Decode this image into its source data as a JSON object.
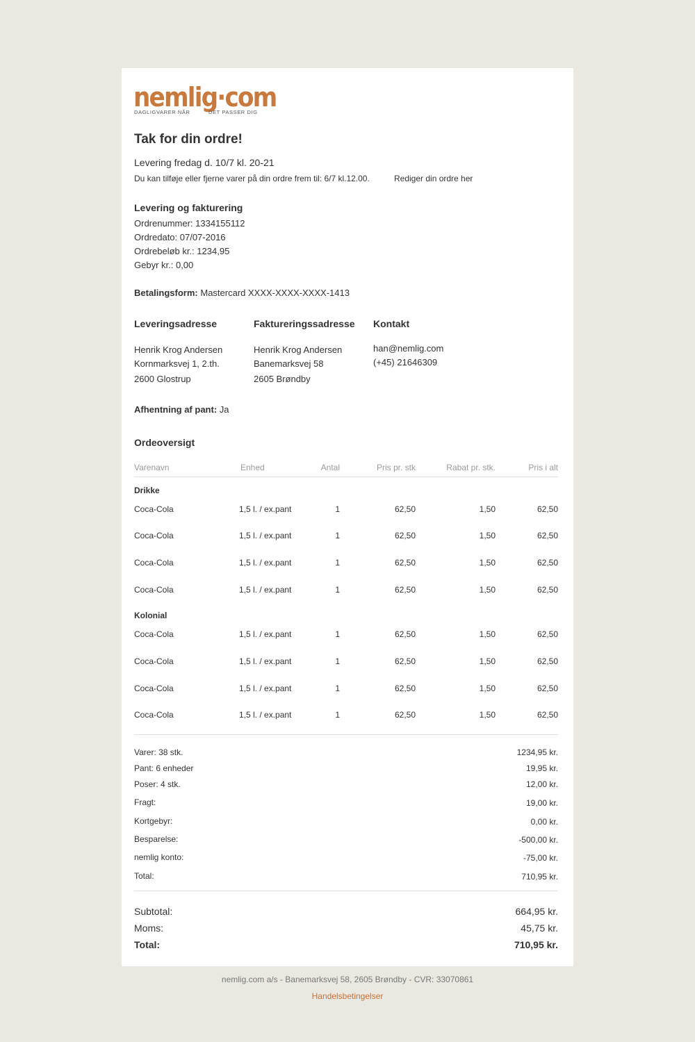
{
  "brand": {
    "logo_text": "nemlig·com",
    "tagline_left": "DAGLIGVARER NÅR",
    "tagline_right": "DET PASSER DIG"
  },
  "heading": "Tak for din ordre!",
  "delivery_line": "Levering fredag d. 10/7 kl. 20-21",
  "edit_note": "Du kan tilføje eller fjerne varer på din ordre frem til: 6/7 kl.12.00.",
  "edit_link": "Rediger din ordre her",
  "billing": {
    "heading": "Levering og fakturering",
    "order_number": "Ordrenummer: 1334155112",
    "order_date": "Ordredato: 07/07-2016",
    "order_amount": "Ordrebeløb kr.: 1234,95",
    "fee": "Gebyr kr.: 0,00"
  },
  "payment": {
    "label": "Betalingsform:",
    "value": "Mastercard XXXX-XXXX-XXXX-1413"
  },
  "addresses": {
    "delivery": {
      "heading": "Leveringsadresse",
      "name": "Henrik Krog Andersen",
      "street": "Kornmarksvej 1, 2.th.",
      "city": "2600 Glostrup"
    },
    "invoice": {
      "heading": "Faktureringssadresse",
      "name": "Henrik Krog Andersen",
      "street": "Banemarksvej 58",
      "city": "2605 Brøndby"
    },
    "contact": {
      "heading": "Kontakt",
      "email": "han@nemlig.com",
      "phone": "(+45) 21646309"
    }
  },
  "deposit_pickup": {
    "label": "Afhentning af pant:",
    "value": "Ja"
  },
  "overview": {
    "heading": "Ordeoversigt",
    "columns": [
      "Varenavn",
      "Enhed",
      "Antal",
      "Pris pr. stk",
      "Rabat pr. stk.",
      "Pris i alt"
    ],
    "groups": [
      {
        "name": "Drikke",
        "rows": [
          [
            "Coca-Cola",
            "1,5 l. / ex.pant",
            "1",
            "62,50",
            "1,50",
            "62,50"
          ],
          [
            "Coca-Cola",
            "1,5 l. / ex.pant",
            "1",
            "62,50",
            "1,50",
            "62,50"
          ],
          [
            "Coca-Cola",
            "1,5 l. / ex.pant",
            "1",
            "62,50",
            "1,50",
            "62,50"
          ],
          [
            "Coca-Cola",
            "1,5 l. / ex.pant",
            "1",
            "62,50",
            "1,50",
            "62,50"
          ]
        ]
      },
      {
        "name": "Kolonial",
        "rows": [
          [
            "Coca-Cola",
            "1,5 l. / ex.pant",
            "1",
            "62,50",
            "1,50",
            "62,50"
          ],
          [
            "Coca-Cola",
            "1,5 l. / ex.pant",
            "1",
            "62,50",
            "1,50",
            "62,50"
          ],
          [
            "Coca-Cola",
            "1,5 l. / ex.pant",
            "1",
            "62,50",
            "1,50",
            "62,50"
          ],
          [
            "Coca-Cola",
            "1,5 l. / ex.pant",
            "1",
            "62,50",
            "1,50",
            "62,50"
          ]
        ]
      }
    ]
  },
  "summary": [
    {
      "label": "Varer:  38 stk.",
      "value": "1234,95 kr.",
      "highlight": false
    },
    {
      "label": "Pant:  6 enheder",
      "value": "19,95 kr.",
      "highlight": false
    },
    {
      "label": "Poser:  4 stk.",
      "value": "12,00 kr.",
      "highlight": false
    },
    {
      "label": "Fragt:",
      "value": "19,00 kr.",
      "highlight": false
    },
    {
      "label": "Kortgebyr:",
      "value": "0,00 kr.",
      "highlight": false
    },
    {
      "label": "Besparelse:",
      "value": "-500,00 kr.",
      "highlight": true
    },
    {
      "label": "nemlig konto:",
      "value": "-75,00 kr.",
      "highlight": true
    },
    {
      "label": "Total:",
      "value": "710,95 kr.",
      "highlight": false
    }
  ],
  "totals": {
    "subtotal_label": "Subtotal:",
    "subtotal_value": "664,95 kr.",
    "vat_label": "Moms:",
    "vat_value": "45,75 kr.",
    "total_label": "Total:",
    "total_value": "710,95 kr."
  },
  "footer": {
    "company": "nemlig.com a/s - Banemarksvej 58, 2605 Brøndby - CVR: 33070861",
    "terms_link": "Handelsbetingelser"
  },
  "colors": {
    "accent": "#c87137",
    "background": "#e9e8e1",
    "card": "#ffffff"
  }
}
